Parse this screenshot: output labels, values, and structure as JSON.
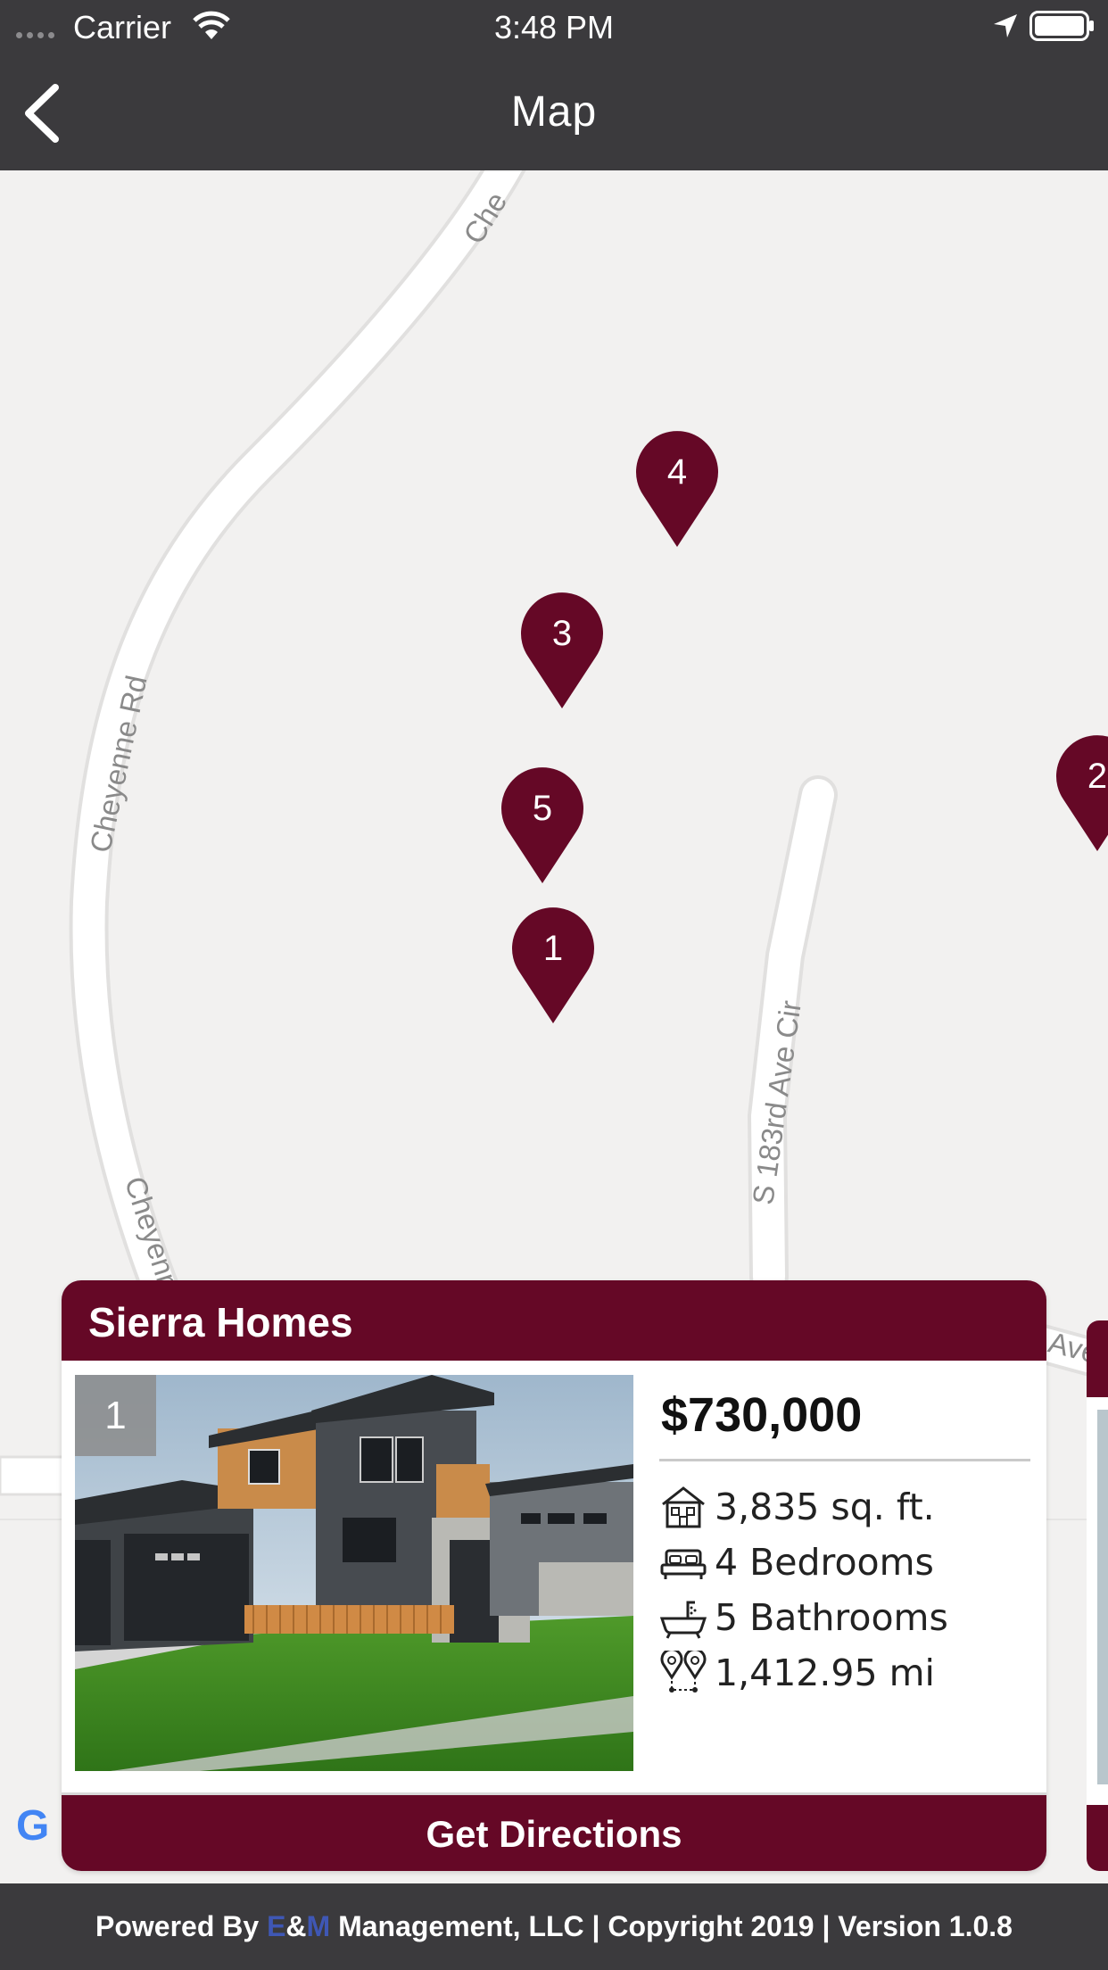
{
  "status_bar": {
    "carrier": "Carrier",
    "time": "3:48 PM"
  },
  "nav": {
    "title": "Map"
  },
  "map": {
    "road_labels": [
      "Che",
      "Cheyenne Rd",
      "Cheyenn",
      "S 183rd Ave Cir",
      "Ave"
    ],
    "pins": [
      "4",
      "3",
      "5",
      "1",
      "2"
    ],
    "provider_mark": "G"
  },
  "card": {
    "title": "Sierra Homes",
    "index": "1",
    "price": "$730,000",
    "specs": {
      "area": "3,835 sq. ft.",
      "bedrooms": "4 Bedrooms",
      "bathrooms": "5 Bathrooms",
      "distance": "1,412.95 mi"
    },
    "directions_label": "Get Directions"
  },
  "footer": {
    "prefix": "Powered By ",
    "brand_e": "E",
    "brand_amp": "&",
    "brand_m": "M",
    "suffix": " Management, LLC | Copyright 2019 | Version 1.0.8"
  },
  "colors": {
    "bar": "#3b3a3d",
    "accent": "#650826",
    "map_bg": "#f2f1f0",
    "brand_blue": "#3f57b5"
  }
}
